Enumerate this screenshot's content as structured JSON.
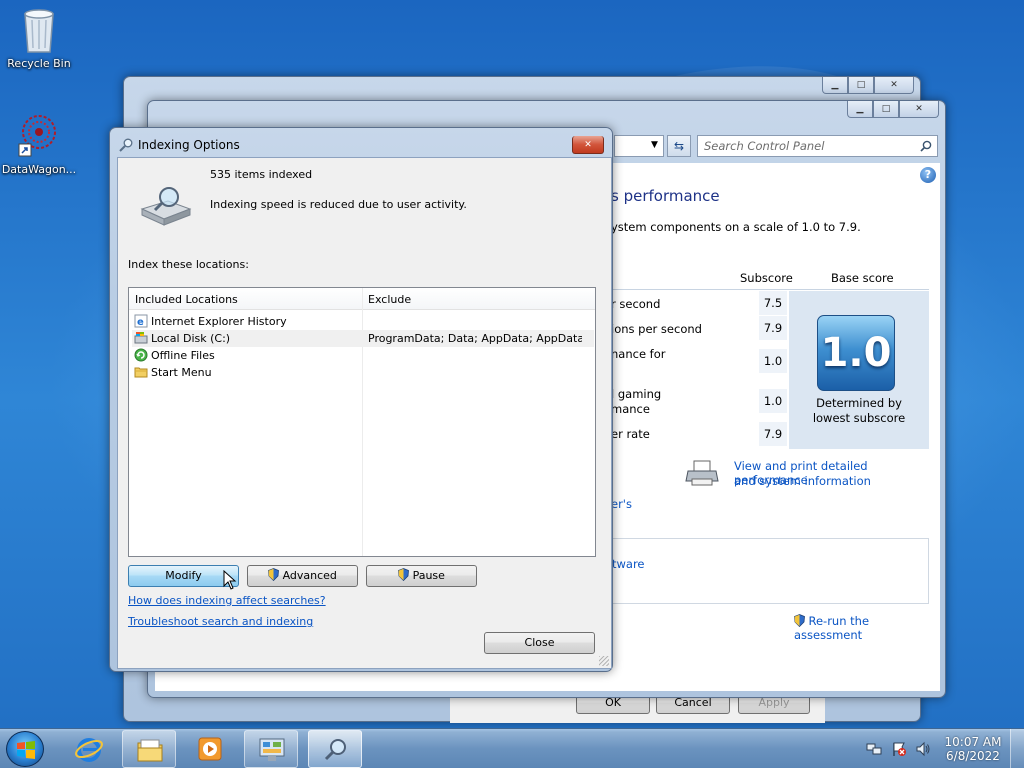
{
  "desktop": {
    "icons": [
      {
        "label": "Recycle Bin"
      },
      {
        "label": "DataWagon..."
      }
    ]
  },
  "back_window": {
    "buttons": {
      "ok": "OK",
      "cancel": "Cancel",
      "apply": "Apply"
    }
  },
  "control_panel": {
    "search_placeholder": "Search Control Panel",
    "heading_fragment": "s performance",
    "description_fragment": "ystem components on a scale of 1.0 to 7.9.",
    "table": {
      "headers": {
        "subscore": "Subscore",
        "base_score": "Base score"
      },
      "rows": [
        {
          "label_fragment": "r second",
          "subscore": "7.5"
        },
        {
          "label_fragment": "ions per second",
          "subscore": "7.9"
        },
        {
          "label_fragment": "nance for",
          "subscore": "1.0"
        },
        {
          "label_fragment_1": "l gaming",
          "label_fragment_2": "mance",
          "subscore": "1.0"
        },
        {
          "label_fragment": "er rate",
          "subscore": "7.9"
        }
      ],
      "base_score": "1.0",
      "base_score_caption_1": "Determined by",
      "base_score_caption_2": "lowest subscore"
    },
    "print_link_1": "View and print detailed performance",
    "print_link_2": "and system information",
    "partial_link_1": "er's",
    "partial_link_2": "tware",
    "rerun_link": "Re-run the assessment"
  },
  "indexing_dialog": {
    "title": "Indexing Options",
    "items_indexed": "535 items indexed",
    "status": "Indexing speed is reduced due to user activity.",
    "locations_label": "Index these locations:",
    "columns": {
      "included": "Included Locations",
      "exclude": "Exclude"
    },
    "locations": [
      {
        "name": "Internet Explorer History",
        "exclude": "",
        "icon": "ie-history-icon"
      },
      {
        "name": "Local Disk (C:)",
        "exclude": "ProgramData; Data; AppData; AppData; ...",
        "icon": "local-disk-icon"
      },
      {
        "name": "Offline Files",
        "exclude": "",
        "icon": "offline-files-icon"
      },
      {
        "name": "Start Menu",
        "exclude": "",
        "icon": "folder-icon"
      }
    ],
    "buttons": {
      "modify": "Modify",
      "advanced": "Advanced",
      "pause": "Pause",
      "close": "Close"
    },
    "links": {
      "how": "How does indexing affect searches?",
      "troubleshoot": "Troubleshoot search and indexing"
    }
  },
  "taskbar": {
    "items": [
      "internet-explorer-icon",
      "windows-explorer-icon",
      "media-player-icon",
      "control-panel-icon",
      "indexing-options-icon"
    ],
    "time": "10:07 AM",
    "date": "6/8/2022"
  }
}
